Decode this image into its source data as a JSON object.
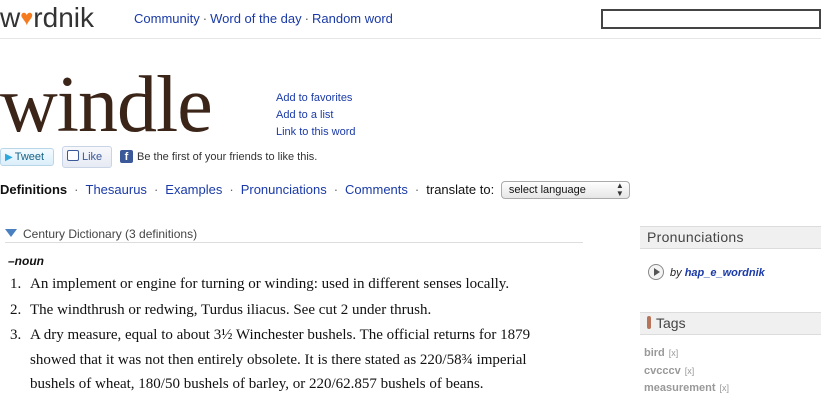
{
  "header": {
    "logo_pre": "w",
    "logo_heart": "♥",
    "logo_post": "rdnik",
    "nav": [
      "Community",
      "Word of the day",
      "Random word"
    ],
    "nav_separator": "·",
    "search_value": ""
  },
  "word": {
    "headword": "windle",
    "links": [
      "Add to favorites",
      "Add to a list",
      "Link to this word"
    ]
  },
  "social": {
    "tweet_label": "Tweet",
    "like_label": "Like",
    "fb_icon": "f",
    "fb_text": "Be the first of your friends to like this."
  },
  "tabs": {
    "active": "Definitions",
    "items": [
      "Thesaurus",
      "Examples",
      "Pronunciations",
      "Comments"
    ],
    "separator": "·",
    "translate_label": "translate to:",
    "language_select": "select language"
  },
  "definitions": {
    "source": "Century Dictionary (3 definitions)",
    "part_of_speech": "–noun",
    "items": [
      {
        "num": "1.",
        "text": "An implement or engine for turning or winding: used in different senses locally."
      },
      {
        "num": "2.",
        "text": "The windthrush or redwing, Turdus iliacus. See cut 2 under thrush."
      },
      {
        "num": "3.",
        "text": "A dry measure, equal to about 3½ Winchester bushels. The official returns for 1879 showed that it was not then entirely obsolete. It is there stated as 220/58¾ imperial bushels of wheat, 180/50 bushels of barley, or 220/62.857 bushels of beans."
      }
    ]
  },
  "sidebar": {
    "pronunciations_title": "Pronunciations",
    "pron_by": "by",
    "pron_user": "hap_e_wordnik",
    "tags_title": "Tags",
    "tags": [
      {
        "name": "bird",
        "remove": "[x]"
      },
      {
        "name": "cvcccv",
        "remove": "[x]"
      },
      {
        "name": "measurement",
        "remove": "[x]"
      }
    ]
  },
  "colors": {
    "link": "#1a3aa8",
    "headword": "#3b2418",
    "logo_heart": "#f47b20",
    "sidebar_bg": "#f0f0f0"
  },
  "icons": [
    "heart-logo-icon",
    "tweet-bird-icon",
    "like-thumb-icon",
    "facebook-icon",
    "collapse-triangle-icon",
    "play-icon",
    "tag-pin-icon",
    "select-arrows-icon"
  ]
}
